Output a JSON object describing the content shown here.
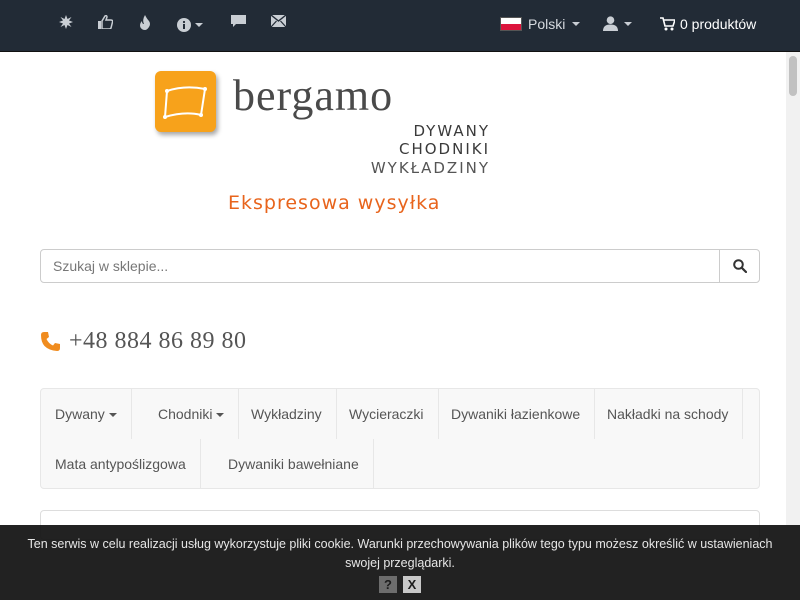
{
  "topbar": {
    "icons": [
      "new-icon",
      "thumbs-up-icon",
      "fire-icon",
      "info-icon",
      "comment-icon",
      "envelope-icon"
    ],
    "language_label": "Polski",
    "cart_label": "0 produktów"
  },
  "logo": {
    "name": "bergamo",
    "line1": "DYWANY",
    "line2": "CHODNIKI",
    "line3": "WYKŁADZINY"
  },
  "tagline": "Ekspresowa wysyłka",
  "search": {
    "placeholder": "Szukaj w sklepie..."
  },
  "phone": "+48 884 86 89 80",
  "nav": {
    "items": [
      {
        "label": "Dywany",
        "dropdown": true
      },
      {
        "label": "Chodniki",
        "dropdown": true
      },
      {
        "label": "Wykładziny",
        "dropdown": false
      },
      {
        "label": "Wycieraczki",
        "dropdown": false
      },
      {
        "label": "Dywaniki łazienkowe",
        "dropdown": false
      },
      {
        "label": "Nakładki na schody",
        "dropdown": false
      },
      {
        "label": "Mata antypoślizgowa",
        "dropdown": false
      },
      {
        "label": "Dywaniki bawełniane",
        "dropdown": false
      }
    ]
  },
  "cookie": {
    "text": "Ten serwis w celu realizacji usług wykorzystuje pliki cookie. Warunki przechowywania plików tego typu możesz określić w ustawieniach swojej przeglądarki.",
    "help_label": "?",
    "close_label": "X"
  },
  "colors": {
    "topbar": "#222b36",
    "accent_orange": "#e8641c",
    "logo_orange": "#f7a21b"
  }
}
